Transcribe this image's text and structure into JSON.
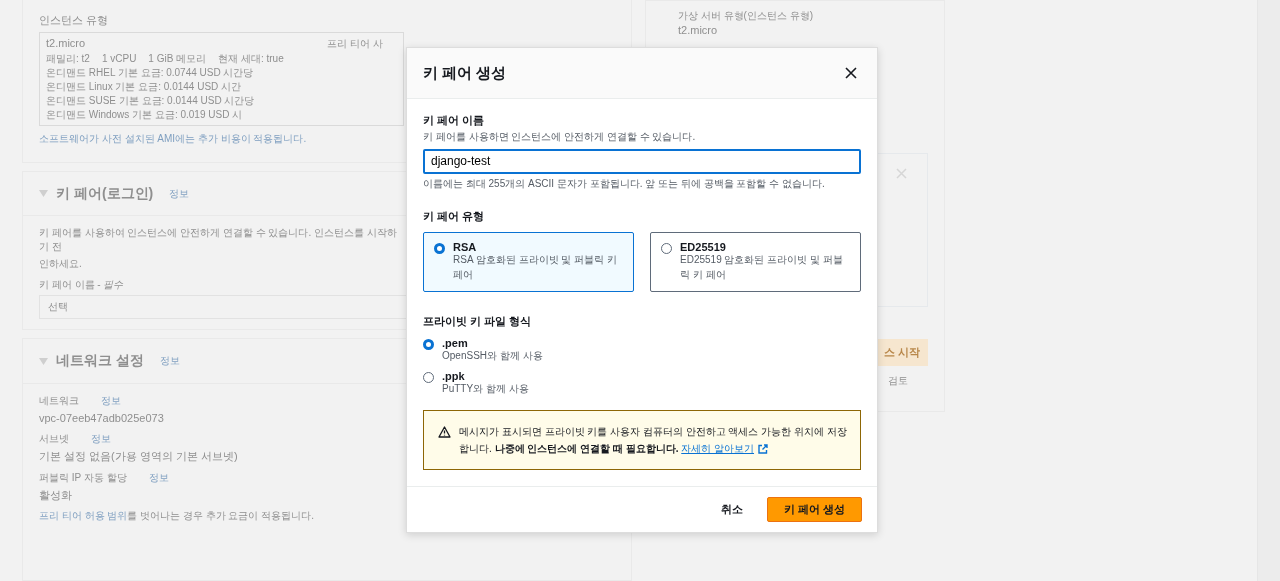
{
  "background": {
    "instance_type": {
      "label": "인스턴스 유형",
      "name": "t2.micro",
      "badge": "프리 티어 사",
      "specs": [
        "패밀리: t2",
        "1 vCPU",
        "1 GiB 메모리",
        "현재 세대: true"
      ],
      "prices": [
        [
          "온디맨드 RHEL 기본 요금: 0.0744 USD 시간당",
          "온디맨드 Linux 기본 요금: 0.0144 USD 시간"
        ],
        [
          "온디맨드 SUSE 기본 요금: 0.0144 USD 시간당",
          "온디맨드 Windows 기본 요금: 0.019 USD 시"
        ]
      ],
      "note": "소프트웨어가 사전 설치된 AMI에는 추가 비용이 적용됩니다."
    },
    "key_pair_section": {
      "title": "키 페어(로그인)",
      "info": "정보",
      "expanded": true,
      "description": [
        "키 페어를 사용하여 인스턴스에 안전하게 연결할 수 있습니다. 인스턴스를 시작하기 전",
        "인하세요."
      ],
      "field_label": "키 페어 이름 - *필수*",
      "placeholder": "선택"
    },
    "network_section": {
      "title": "네트워크 설정",
      "info": "정보",
      "expanded": true,
      "fields": [
        {
          "label": "네트워크",
          "info": "정보",
          "value": "vpc-07eeb47adb025e073"
        },
        {
          "label": "서브넷",
          "info": "정보",
          "value": "기본 설정 없음(가용 영역의 기본 서브넷)"
        },
        {
          "label": "퍼블릭 IP 자동 할당",
          "info": "정보",
          "value": "활성화"
        }
      ],
      "note_link": "프리 티어 허용 범위",
      "note_text": "를 벗어나는 경우 추가 요금이 적용됩니다."
    },
    "summary": {
      "title": "가상 서버 유형(인스턴스 유형)",
      "value": "t2.micro",
      "launch_button": "스 시작",
      "review_link": "검토"
    }
  },
  "modal": {
    "title": "키 페어 생성",
    "name_field": {
      "label": "키 페어 이름",
      "description": "키 페어를 사용하면 인스턴스에 안전하게 연결할 수 있습니다.",
      "value": "django-test",
      "constraint": "이름에는 최대 255개의 ASCII 문자가 포함됩니다. 앞 또는 뒤에 공백을 포함할 수 없습니다."
    },
    "type_label": "키 페어 유형",
    "types": [
      {
        "label": "RSA",
        "description": "RSA 암호화된 프라이빗 및 퍼블릭 키 페어",
        "selected": true
      },
      {
        "label": "ED25519",
        "description": "ED25519 암호화된 프라이빗 및 퍼블릭 키 페어",
        "selected": false
      }
    ],
    "format_label": "프라이빗 키 파일 형식",
    "formats": [
      {
        "label": ".pem",
        "description": "OpenSSH와 함께 사용",
        "selected": true
      },
      {
        "label": ".ppk",
        "description": "PuTTY와 함께 사용",
        "selected": false
      }
    ],
    "alert": {
      "text": "메시지가 표시되면 프라이빗 키를 사용자 컴퓨터의 안전하고 액세스 가능한 위치에 저장합니다. **나중에 인스턴스에 연결할 때 필요합니다.**",
      "link": "자세히 알아보기"
    },
    "buttons": [
      {
        "label": "취소",
        "kind": "link"
      },
      {
        "label": "키 페어 생성",
        "kind": "primary"
      }
    ]
  }
}
